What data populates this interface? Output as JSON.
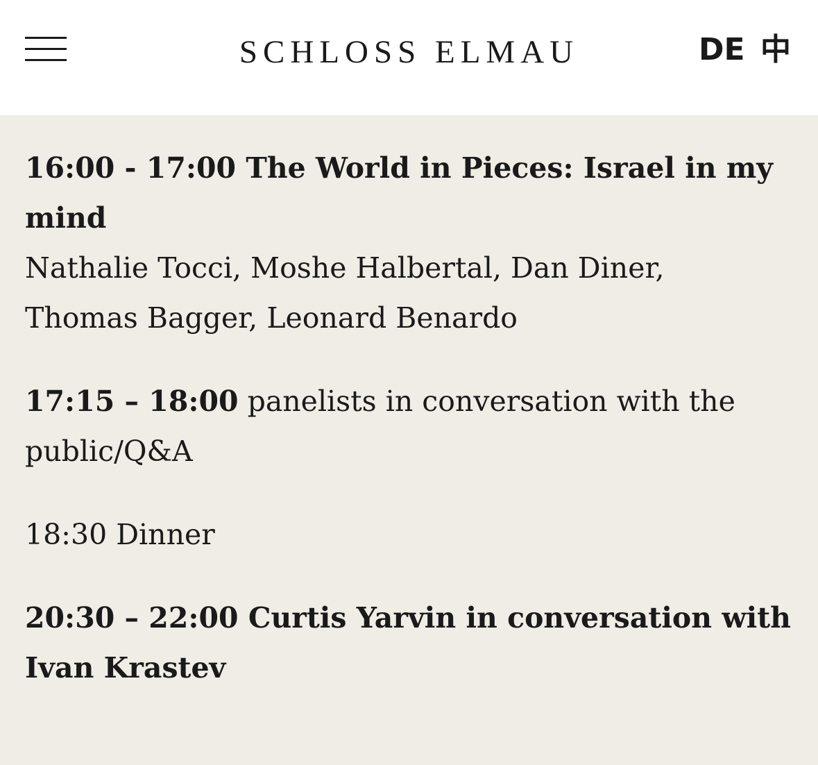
{
  "header": {
    "logo": "SCHLOSS ELMAU",
    "lang_de": "DE",
    "lang_zh": "中"
  },
  "program": [
    {
      "title": "16:00 - 17:00 The World in Pieces: Israel in my mind",
      "speakers_line1": "Nathalie Tocci, Moshe Halbertal, Dan Diner,",
      "speakers_line2": "Thomas Bagger, Leonard Benardo"
    },
    {
      "time": "17:15 – 18:00",
      "text": " panelists in conversation with the public/Q&A"
    },
    {
      "text": "18:30 Dinner"
    },
    {
      "title": "20:30 – 22:00 Curtis Yarvin in conversation with Ivan Krastev"
    }
  ]
}
